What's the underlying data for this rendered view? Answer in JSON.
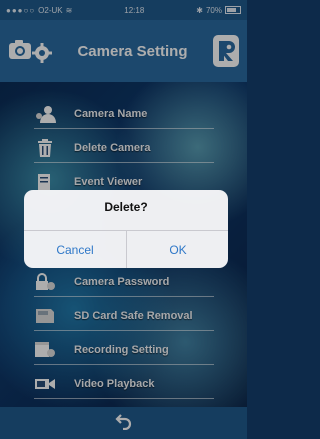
{
  "status_bar": {
    "carrier": "O2-UK",
    "time": "12:18",
    "battery": "70%"
  },
  "header": {
    "title": "Camera Setting"
  },
  "menu": [
    {
      "label": "Camera Name",
      "icon": "camera-name-icon"
    },
    {
      "label": "Delete Camera",
      "icon": "trash-icon"
    },
    {
      "label": "Event Viewer",
      "icon": "event-viewer-icon"
    },
    {
      "label": "Camera Password",
      "icon": "lock-gear-icon"
    },
    {
      "label": "SD Card Safe Removal",
      "icon": "sd-card-icon"
    },
    {
      "label": "Recording Setting",
      "icon": "recording-icon"
    },
    {
      "label": "Video Playback",
      "icon": "video-playback-icon"
    }
  ],
  "dialog": {
    "title": "Delete?",
    "cancel_label": "Cancel",
    "ok_label": "OK"
  },
  "colors": {
    "header_bg": "#2a6aa1",
    "status_bg": "#1f5a8c",
    "dialog_button": "#2f78c8"
  }
}
